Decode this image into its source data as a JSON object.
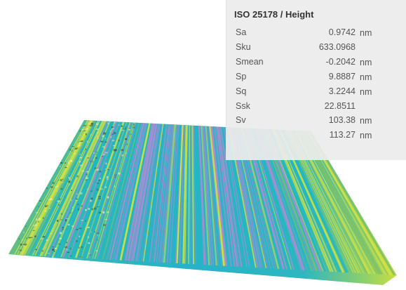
{
  "colors": {
    "low": "#8a93d8",
    "violet": "#b48ad2",
    "mid": "#1eb8c4",
    "green": "#7cc06a",
    "high": "#d7e23c",
    "panel_bg": "#ececec"
  },
  "surface": {
    "icon": "surface-3d-height-map"
  },
  "panel": {
    "title": "ISO 25178 / Height",
    "rows": [
      {
        "name": "Sa",
        "value": "0.9742",
        "unit": "nm"
      },
      {
        "name": "Sku",
        "value": "633.0968",
        "unit": ""
      },
      {
        "name": "Smean",
        "value": "-0.2042",
        "unit": "nm"
      },
      {
        "name": "Sp",
        "value": "9.8887",
        "unit": "nm"
      },
      {
        "name": "Sq",
        "value": "3.2244",
        "unit": "nm"
      },
      {
        "name": "Ssk",
        "value": "22.8511",
        "unit": ""
      },
      {
        "name": "Sv",
        "value": "103.38",
        "unit": "nm"
      },
      {
        "name": "",
        "value": "113.27",
        "unit": "nm"
      }
    ]
  }
}
